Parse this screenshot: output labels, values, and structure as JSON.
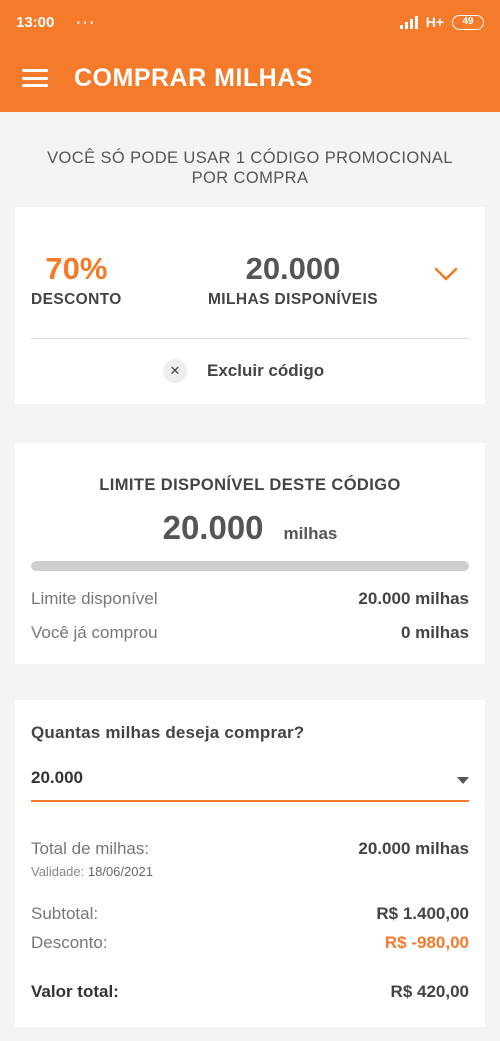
{
  "status_bar": {
    "time": "13:00",
    "dots": "···",
    "network": "H+",
    "battery": "49"
  },
  "app_bar": {
    "title": "COMPRAR MILHAS"
  },
  "notice": {
    "line1": "VOCÊ SÓ PODE USAR 1 CÓDIGO PROMOCIONAL",
    "line2": "POR COMPRA"
  },
  "promo_card": {
    "discount_value": "70%",
    "discount_label": "DESCONTO",
    "miles_value": "20.000",
    "miles_label": "MILHAS DISPONÍVEIS",
    "remove_label": "Excluir código"
  },
  "limit_card": {
    "title": "LIMITE DISPONÍVEL DESTE CÓDIGO",
    "value": "20.000",
    "unit": "milhas",
    "progress_fraction": 0,
    "available_label": "Limite disponível",
    "available_value": "20.000 milhas",
    "bought_label": "Você já comprou",
    "bought_value": "0 milhas"
  },
  "purchase_card": {
    "question": "Quantas milhas deseja comprar?",
    "selected": "20.000",
    "total_label": "Total de milhas:",
    "total_value": "20.000 milhas",
    "validity_label": "Validade:",
    "validity_value": "18/06/2021",
    "subtotal_label": "Subtotal:",
    "subtotal_value": "R$ 1.400,00",
    "discount_label": "Desconto:",
    "discount_value": "R$ -980,00",
    "grand_total_label": "Valor total:",
    "grand_total_value": "R$ 420,00"
  },
  "colors": {
    "brand": "#f57a2a",
    "background": "#f4f4f4"
  },
  "icons": {
    "menu": "hamburger-icon",
    "expand": "chevron-down-icon",
    "remove": "close-icon",
    "dropdown": "caret-down-icon"
  }
}
